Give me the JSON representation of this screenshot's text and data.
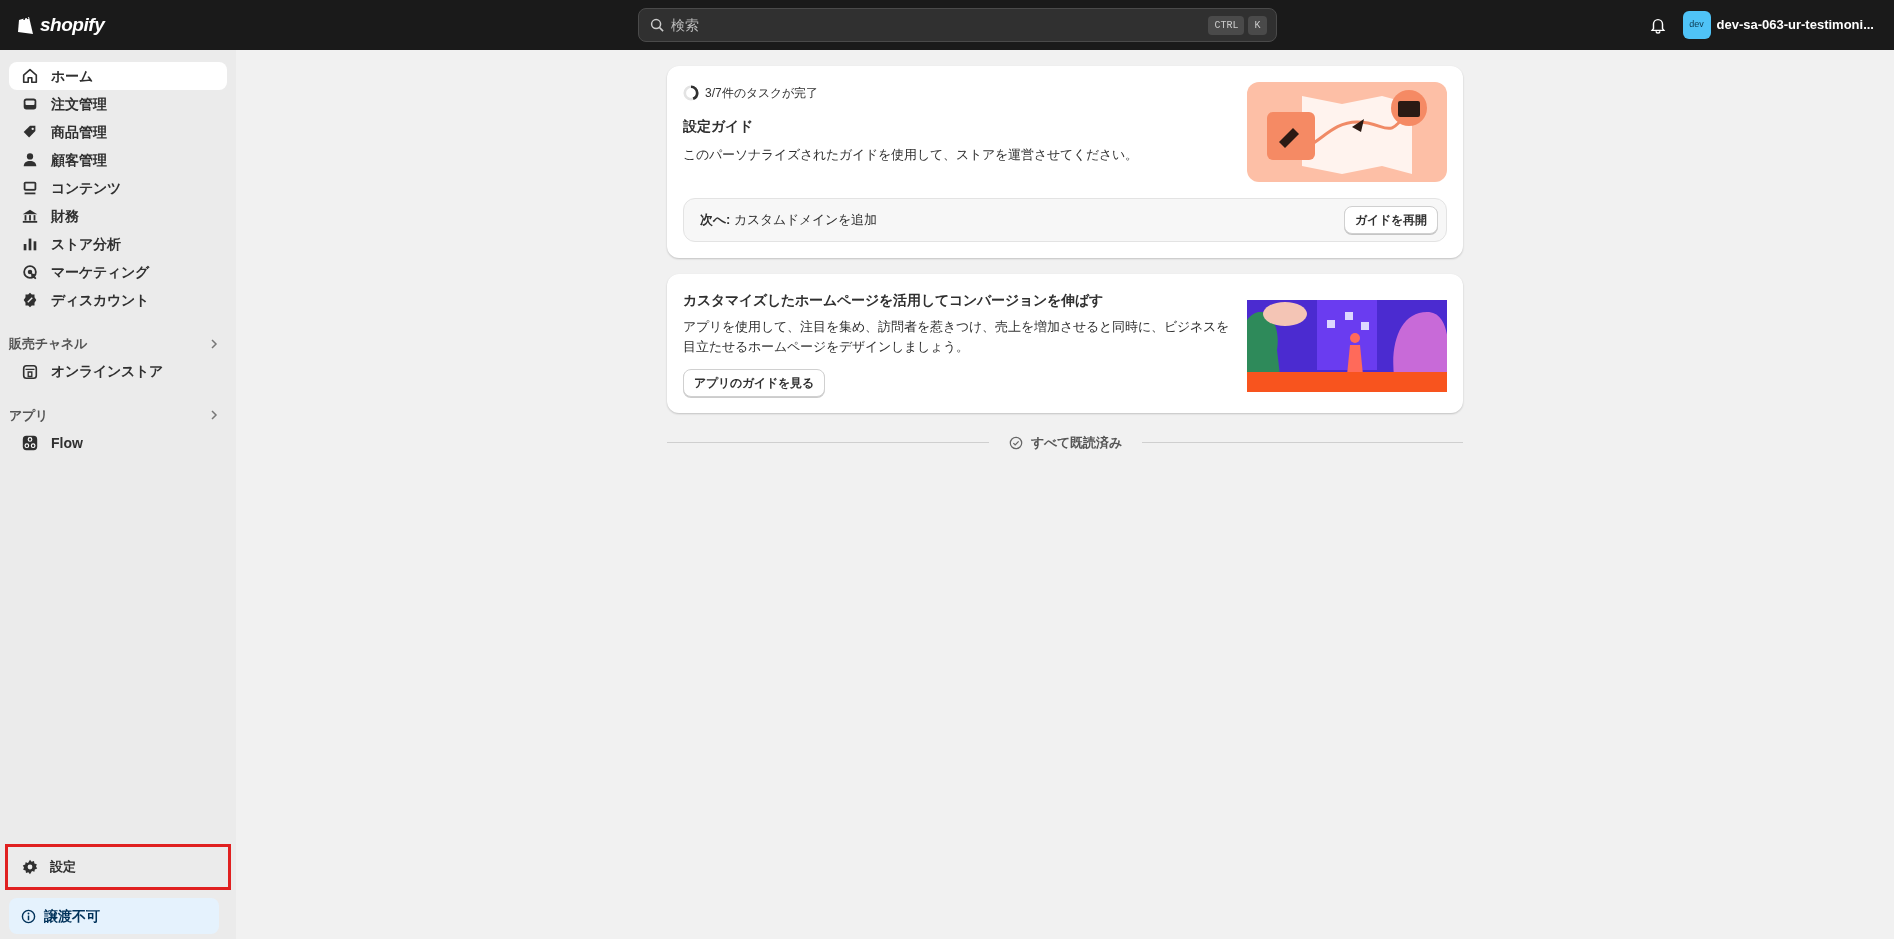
{
  "top_bar": {
    "logo": "shopify",
    "search": {
      "placeholder": "検索",
      "shortcut": [
        "CTRL",
        "K"
      ]
    },
    "avatar": "dev",
    "store_name": "dev-sa-063-ur-testimoni..."
  },
  "sidebar": {
    "items": [
      {
        "kind": "home",
        "label": "ホーム",
        "selected": true
      },
      {
        "kind": "orders",
        "label": "注文管理",
        "selected": false
      },
      {
        "kind": "products",
        "label": "商品管理",
        "selected": false
      },
      {
        "kind": "customers",
        "label": "顧客管理",
        "selected": false
      },
      {
        "kind": "content",
        "label": "コンテンツ",
        "selected": false
      },
      {
        "kind": "finance",
        "label": "財務",
        "selected": false
      },
      {
        "kind": "analytics",
        "label": "ストア分析",
        "selected": false
      },
      {
        "kind": "marketing",
        "label": "マーケティング",
        "selected": false
      },
      {
        "kind": "discounts",
        "label": "ディスカウント",
        "selected": false
      }
    ],
    "sections": [
      {
        "title": "販売チャネル",
        "items": [
          {
            "kind": "store",
            "label": "オンラインストア"
          }
        ]
      },
      {
        "title": "アプリ",
        "items": [
          {
            "kind": "flow",
            "label": "Flow"
          }
        ]
      }
    ],
    "settings": {
      "label": "設定",
      "highlighted": true
    },
    "notice": "譲渡不可"
  },
  "setup_guide": {
    "progress": {
      "label": "3/7件のタスクが完了",
      "level": 0.43
    },
    "title": "設定ガイド",
    "description": "このパーソナライズされたガイドを使用して、ストアを運営させてください。",
    "next": "**次へ:** カスタムドメインを追加",
    "button": "ガイドを再開"
  },
  "promo_card": {
    "title": "カスタマイズしたホームページを活用してコンバージョンを伸ばす",
    "description": "アプリを使用して、注目を集め、訪問者を惹きつけ、売上を増加させると同時に、ビジネスを目立たせるホームページをデザインしましょう。",
    "button": "アプリのガイドを見る"
  },
  "all_read": "すべて既読済み"
}
